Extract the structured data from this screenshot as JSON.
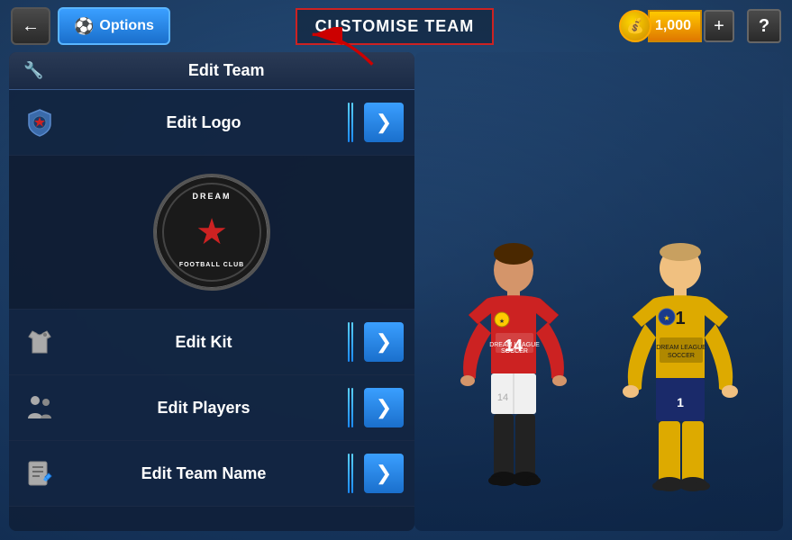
{
  "topbar": {
    "back_label": "←",
    "options_label": "Options",
    "customize_team_label": "CUSTOMISE TEAM",
    "coins_value": "1,000",
    "plus_label": "+",
    "help_label": "?"
  },
  "panel": {
    "header_icon": "🔧",
    "header_title": "Edit Team",
    "menu_items": [
      {
        "id": "edit-logo",
        "icon": "🛡",
        "label": "Edit Logo",
        "has_arrow": true
      },
      {
        "id": "edit-kit",
        "icon": "👕",
        "label": "Edit Kit",
        "has_arrow": true
      },
      {
        "id": "edit-players",
        "icon": "👥",
        "label": "Edit Players",
        "has_arrow": true
      },
      {
        "id": "edit-team-name",
        "icon": "📋",
        "label": "Edit Team Name",
        "has_arrow": true
      }
    ]
  },
  "logo": {
    "text_top": "DREAM",
    "text_bottom": "FOOTBALL CLUB"
  }
}
